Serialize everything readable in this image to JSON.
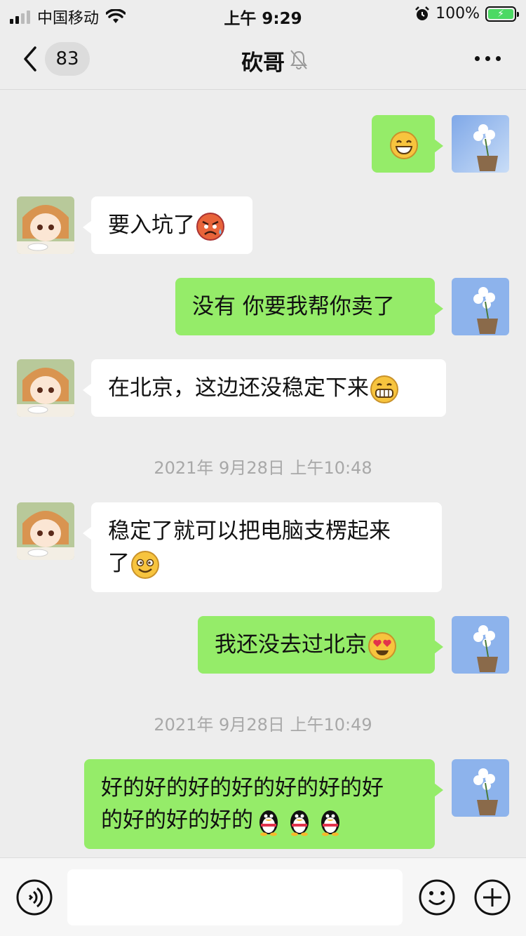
{
  "status_bar": {
    "carrier": "中国移动",
    "time": "上午 9:29",
    "battery_percent": "100%",
    "icons": [
      "signal-icon",
      "wifi-icon",
      "alarm-icon",
      "battery-icon"
    ]
  },
  "nav": {
    "unread_count": "83",
    "title": "砍哥",
    "icons": [
      "back-icon",
      "mute-bell-icon",
      "more-icon"
    ]
  },
  "messages": [
    {
      "side": "right",
      "text": "",
      "emojis": [
        "grin-icon"
      ]
    },
    {
      "side": "left",
      "text": "要入坑了",
      "emojis": [
        "angry-sweat-icon"
      ]
    },
    {
      "side": "right",
      "text": "没有 你要我帮你卖了",
      "emojis": []
    },
    {
      "side": "left",
      "text": "在北京，这边还没稳定下来",
      "emojis": [
        "grimace-icon"
      ]
    },
    {
      "side": "left",
      "text_line1": "稳定了就可以把电脑支楞起来",
      "text_line2": "了",
      "emojis": [
        "dizzy-smile-icon"
      ]
    },
    {
      "side": "right",
      "text": "我还没去过北京",
      "emojis": [
        "heart-eyes-icon"
      ]
    },
    {
      "side": "right",
      "text_line1": "好的好的好的好的好的好的好",
      "text_line2": "的好的好的好的",
      "emojis": [
        "penguin-icon",
        "penguin-icon",
        "penguin-icon"
      ]
    }
  ],
  "timestamps": [
    "2021年 9月28日 上午10:48",
    "2021年 9月28日 上午10:49"
  ],
  "input_bar": {
    "placeholder": "",
    "icons": [
      "voice-icon",
      "emoji-icon",
      "plus-icon"
    ]
  },
  "colors": {
    "background": "#EDEDED",
    "bubble_sent": "#95EC69",
    "bubble_received": "#FFFFFF",
    "timestamp_text": "#A8A8A8"
  }
}
